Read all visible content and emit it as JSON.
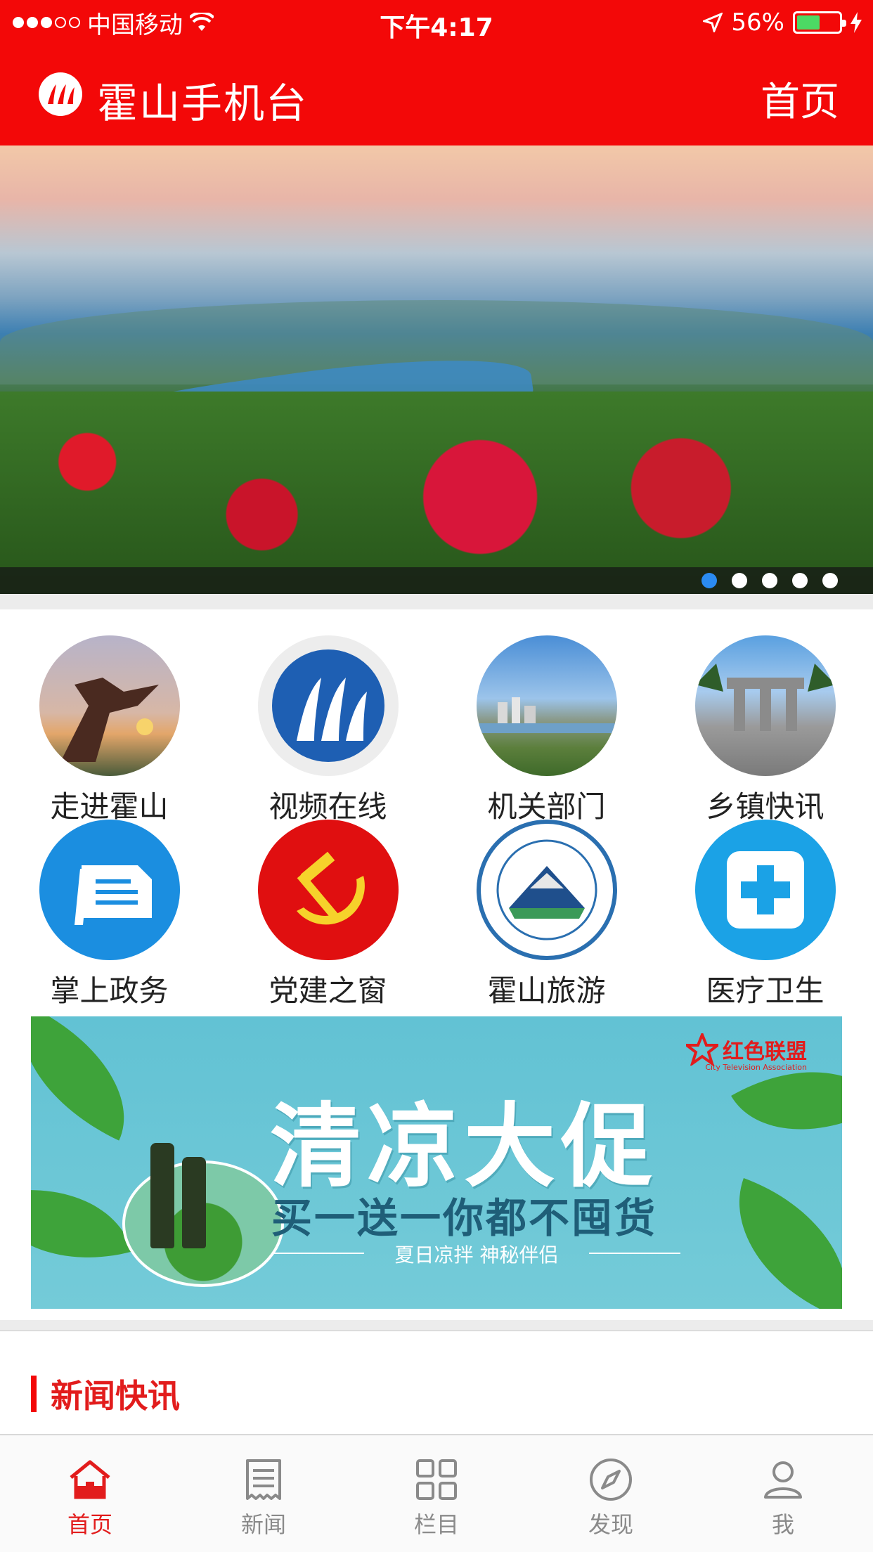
{
  "status_bar": {
    "carrier": "中国移动",
    "time": "下午4:17",
    "battery_percent": "56%",
    "battery_level": 0.56
  },
  "header": {
    "title": "霍山手机台",
    "home_link": "首页"
  },
  "banner": {
    "slide_count": 5,
    "active_slide": 1
  },
  "grid": {
    "items": [
      {
        "label": "走进霍山"
      },
      {
        "label": "视频在线"
      },
      {
        "label": "机关部门"
      },
      {
        "label": "乡镇快讯"
      },
      {
        "label": "掌上政务"
      },
      {
        "label": "党建之窗"
      },
      {
        "label": "霍山旅游"
      },
      {
        "label": "医疗卫生"
      }
    ]
  },
  "promo": {
    "title": "清凉大促",
    "subtitle": "买一送一你都不囤货",
    "tagline": "夏日凉拌  神秘伴侣",
    "brand": "红色联盟",
    "brand_en": "City Television Association"
  },
  "news": {
    "section_title": "新闻快讯"
  },
  "tabbar": {
    "items": [
      {
        "label": "首页",
        "icon": "home-icon"
      },
      {
        "label": "新闻",
        "icon": "news-icon"
      },
      {
        "label": "栏目",
        "icon": "grid-icon"
      },
      {
        "label": "发现",
        "icon": "compass-icon"
      },
      {
        "label": "我",
        "icon": "user-icon"
      }
    ],
    "active": 0
  },
  "colors": {
    "brand_red": "#f30808",
    "active_dot": "#2b8bf2",
    "inactive_tab": "#8a8a8a"
  }
}
